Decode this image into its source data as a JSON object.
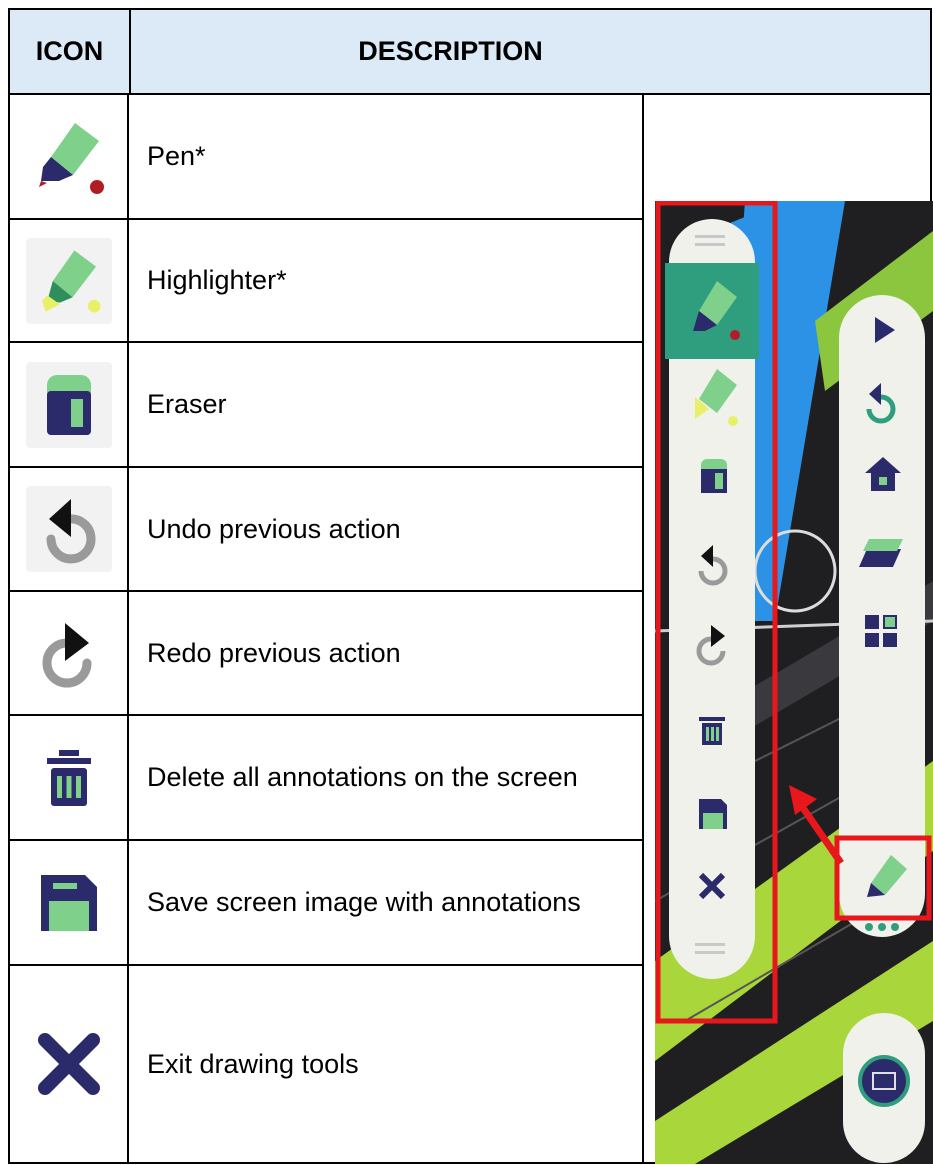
{
  "header": {
    "icon": "ICON",
    "description": "DESCRIPTION"
  },
  "rows": [
    {
      "icon": "pen-icon",
      "label": "Pen*"
    },
    {
      "icon": "highlighter-icon",
      "label": "Highlighter*"
    },
    {
      "icon": "eraser-icon",
      "label": "Eraser"
    },
    {
      "icon": "undo-icon",
      "label": "Undo previous action"
    },
    {
      "icon": "redo-icon",
      "label": "Redo previous action"
    },
    {
      "icon": "trash-icon",
      "label": "Delete all annotations on the screen"
    },
    {
      "icon": "save-icon",
      "label": "Save screen image with annotations"
    },
    {
      "icon": "close-icon",
      "label": "Exit drawing tools"
    }
  ],
  "colors": {
    "navy": "#2b2a6b",
    "green": "#7ed08a",
    "teal": "#2f9e7e",
    "red": "#b01d25",
    "yellow": "#e8f06a",
    "highlight_frame": "#e8171c",
    "header_bg": "#dce9f7"
  }
}
